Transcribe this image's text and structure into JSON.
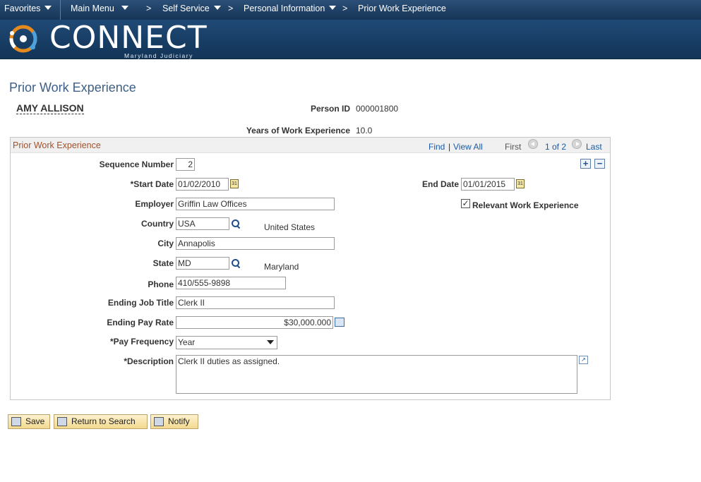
{
  "nav": {
    "favorites": "Favorites",
    "main_menu": "Main Menu",
    "self_service": "Self Service",
    "personal_information": "Personal Information",
    "current": "Prior Work Experience",
    "sep": ">"
  },
  "banner": {
    "logo_text": "CONNECT",
    "logo_sub": "Maryland Judiciary"
  },
  "page": {
    "title": "Prior Work Experience",
    "person_name": "AMY ALLISON",
    "person_id_label": "Person ID",
    "person_id": "000001800",
    "years_label": "Years of Work Experience",
    "years": "10.0"
  },
  "group": {
    "title": "Prior Work Experience",
    "find": "Find",
    "pipe": "|",
    "view_all": "View All",
    "first": "First",
    "count": "1 of 2",
    "last": "Last"
  },
  "form": {
    "sequence_label": "Sequence Number",
    "sequence": "2",
    "start_date_label": "*Start Date",
    "start_date": "01/02/2010",
    "end_date_label": "End Date",
    "end_date": "01/01/2015",
    "employer_label": "Employer",
    "employer": "Griffin Law Offices",
    "relevant_label": "Relevant Work Experience",
    "relevant_check": "✓",
    "country_label": "Country",
    "country": "USA",
    "country_desc": "United States",
    "city_label": "City",
    "city": "Annapolis",
    "state_label": "State",
    "state": "MD",
    "state_desc": "Maryland",
    "phone_label": "Phone",
    "phone": "410/555-9898",
    "job_title_label": "Ending Job Title",
    "job_title": "Clerk II",
    "pay_rate_label": "Ending Pay Rate",
    "pay_rate": "$30,000.000",
    "pay_freq_label": "*Pay Frequency",
    "pay_freq": "Year",
    "description_label": "*Description",
    "description": "Clerk II duties as assigned."
  },
  "buttons": {
    "save": "Save",
    "return": "Return to Search",
    "notify": "Notify"
  },
  "icons": {
    "calendar": "31",
    "plus": "+",
    "minus": "−",
    "expand": "↗"
  }
}
